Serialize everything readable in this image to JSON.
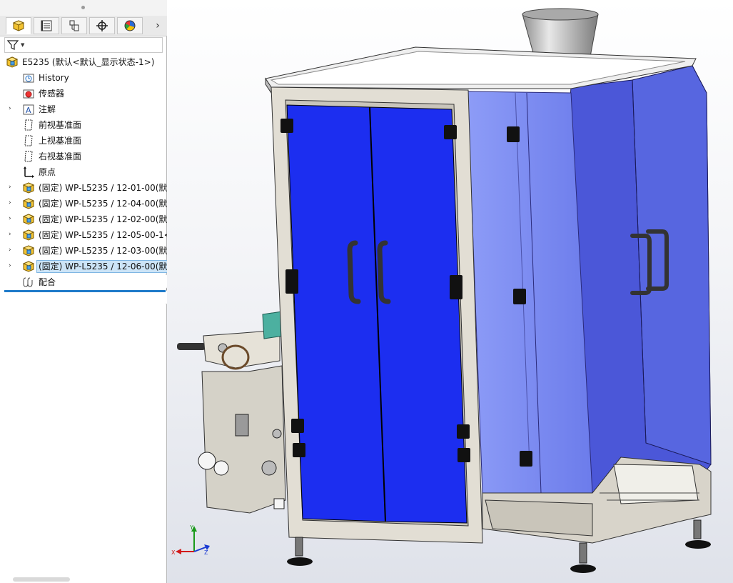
{
  "feature_tree": {
    "tabs": [
      {
        "name": "FeatureManager",
        "icon": "featuremanager-tab-icon"
      },
      {
        "name": "PropertyManager",
        "icon": "propertymanager-tab-icon"
      },
      {
        "name": "ConfigurationManager",
        "icon": "configurationmanager-tab-icon"
      },
      {
        "name": "DimXpertManager",
        "icon": "dimxpert-tab-icon"
      },
      {
        "name": "DisplayManager",
        "icon": "displaymanager-tab-icon"
      }
    ],
    "more_tabs_glyph": "›",
    "root": {
      "label": "E5235  (默认<默认_显示状态-1>)"
    },
    "items": [
      {
        "label": "History",
        "icon": "history-folder-icon",
        "expandable": false
      },
      {
        "label": "传感器",
        "icon": "sensor-folder-icon",
        "expandable": false
      },
      {
        "label": "注解",
        "icon": "annotation-folder-icon",
        "expandable": true
      },
      {
        "label": "前视基准面",
        "icon": "plane-icon",
        "expandable": false
      },
      {
        "label": "上视基准面",
        "icon": "plane-icon",
        "expandable": false
      },
      {
        "label": "右视基准面",
        "icon": "plane-icon",
        "expandable": false
      },
      {
        "label": "原点",
        "icon": "origin-icon",
        "expandable": false
      },
      {
        "label": "(固定) WP-L5235 / 12-01-00(默认",
        "icon": "subassembly-icon",
        "expandable": true
      },
      {
        "label": "(固定) WP-L5235 / 12-04-00(默认",
        "icon": "subassembly-icon",
        "expandable": true
      },
      {
        "label": "(固定) WP-L5235 / 12-02-00(默认",
        "icon": "subassembly-icon",
        "expandable": true
      },
      {
        "label": "(固定) WP-L5235 / 12-05-00-1<",
        "icon": "subassembly-icon",
        "expandable": true
      },
      {
        "label": "(固定) WP-L5235 / 12-03-00(默认",
        "icon": "subassembly-icon",
        "expandable": true
      },
      {
        "label": "(固定) WP-L5235 / 12-06-00(默认",
        "icon": "subassembly-icon",
        "expandable": true,
        "selected": true
      },
      {
        "label": "配合",
        "icon": "mates-folder-icon",
        "expandable": false
      }
    ]
  },
  "viewport": {
    "triad_axes": {
      "x": "X",
      "y": "Y",
      "z": "Z"
    },
    "colors": {
      "door_blue": "#1c2ef0",
      "side_panel": "#7f8ff0",
      "frame": "#e0ddd4",
      "hopper": "#c9c9c9",
      "top_plate": "#eeeeee"
    }
  }
}
